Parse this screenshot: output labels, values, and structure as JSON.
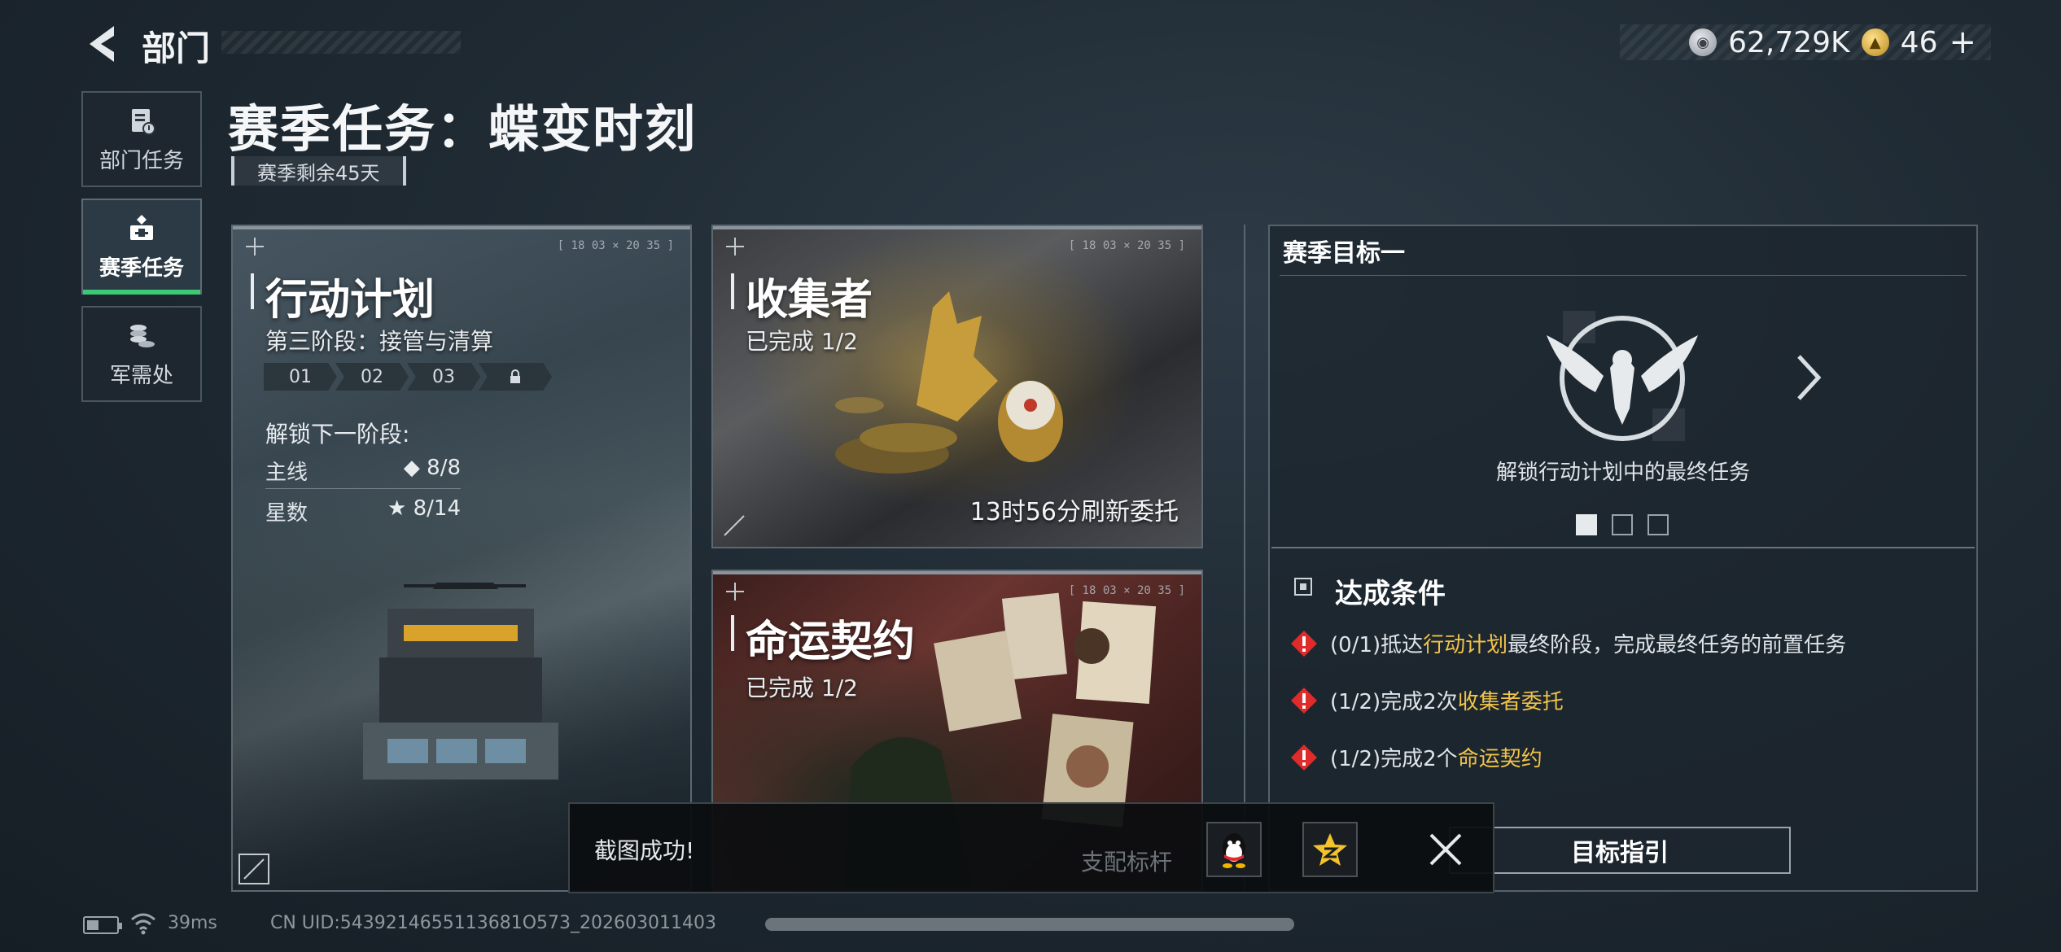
{
  "header": {
    "title": "部门",
    "currencies": [
      {
        "icon": "silver-coin-icon",
        "value": "62,729K"
      },
      {
        "icon": "gold-coin-icon",
        "value": "46"
      }
    ],
    "plus_label": "+"
  },
  "sidebar": {
    "items": [
      {
        "label": "部门任务",
        "icon": "clipboard-icon",
        "active": false
      },
      {
        "label": "赛季任务",
        "icon": "kit-icon",
        "active": true
      },
      {
        "label": "军需处",
        "icon": "coin-stack-icon",
        "active": false
      }
    ]
  },
  "season": {
    "title": "赛季任务：蝶变时刻",
    "remaining": "赛季剩余45天"
  },
  "cards": {
    "action": {
      "title": "行动计划",
      "subtitle": "第三阶段：接管与清算",
      "stages": [
        "01",
        "02",
        "03"
      ],
      "locked_stage_icon": "lock-icon",
      "unlock_label": "解锁下一阶段:",
      "main_label": "主线",
      "main_value": "◆ 8/8",
      "stars_label": "星数",
      "stars_value": "★ 8/14",
      "hud": "[ 18 03 × 20 35 ]"
    },
    "collector": {
      "title": "收集者",
      "subtitle": "已完成 1/2",
      "refresh": "13时56分刷新委托",
      "hud": "[ 18 03 × 20 35 ]"
    },
    "fate": {
      "title": "命运契约",
      "subtitle": "已完成 1/2",
      "hud": "[ 18 03 × 20 35 ]"
    }
  },
  "goal": {
    "title": "赛季目标一",
    "emblem": "eagle-emblem-icon",
    "description": "解锁行动计划中的最终任务",
    "page_count": 3,
    "active_page": 1,
    "conditions_title": "达成条件",
    "conditions": [
      {
        "prefix": "(0/1)抵达",
        "highlight": "行动计划",
        "suffix": "最终阶段，完成最终任务的前置任务"
      },
      {
        "prefix": "(1/2)完成2次",
        "highlight": "收集者委托",
        "suffix": ""
      },
      {
        "prefix": "(1/2)完成2个",
        "highlight": "命运契约",
        "suffix": ""
      }
    ],
    "guide_button": "目标指引"
  },
  "toast": {
    "message": "截图成功!",
    "background_label": "支配标杆",
    "share_buttons": [
      "qq-icon",
      "qzone-star-icon"
    ]
  },
  "status": {
    "ping": "39ms",
    "uid": "CN UID:5439214655113681O573_202603011403"
  },
  "colors": {
    "accent_green": "#3cc874",
    "highlight_yellow": "#f0c34a",
    "warning_red": "#e02b2b"
  }
}
